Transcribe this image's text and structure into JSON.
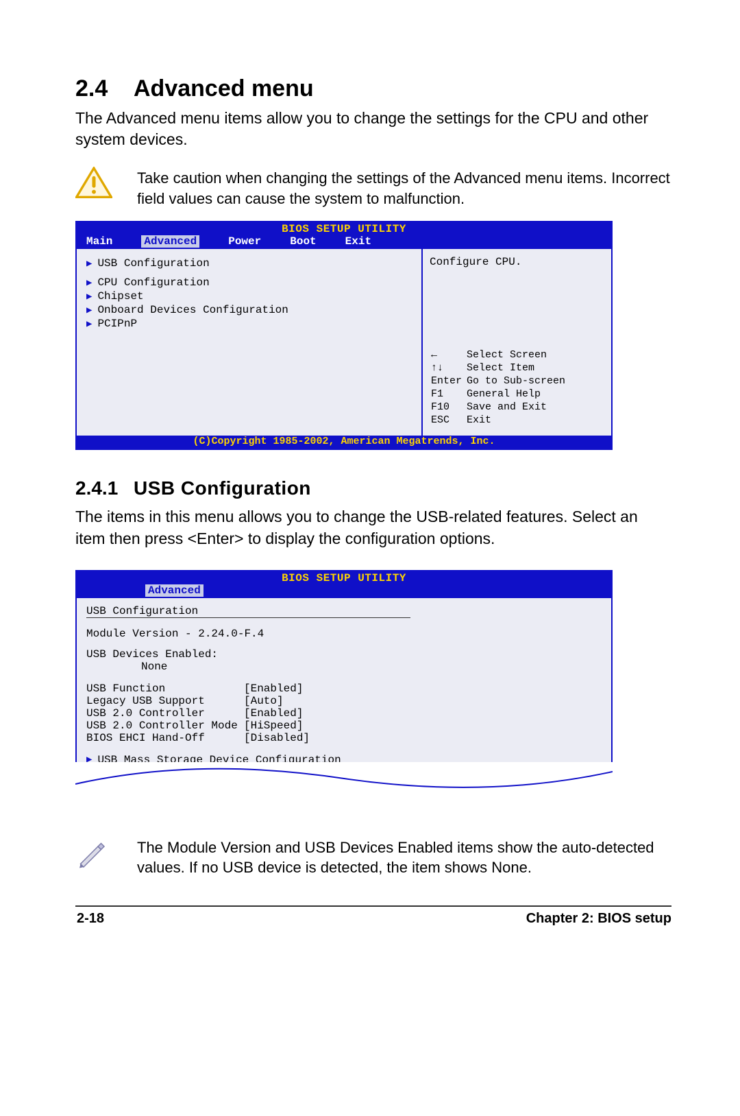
{
  "section": {
    "num": "2.4",
    "title": "Advanced menu"
  },
  "intro": "The Advanced menu items allow you to change the settings for the CPU and other system devices.",
  "caution": "Take caution when changing the settings of the Advanced menu items. Incorrect field values can cause the system to malfunction.",
  "bios1": {
    "title": "BIOS SETUP UTILITY",
    "tabs": [
      "Main",
      "Advanced",
      "Power",
      "Boot",
      "Exit"
    ],
    "activeTab": "Advanced",
    "items": [
      "USB Configuration",
      "CPU Configuration",
      "Chipset",
      "Onboard Devices Configuration",
      "PCIPnP"
    ],
    "rightTop": "Configure CPU.",
    "keys": [
      {
        "k": "←",
        "d": "Select Screen"
      },
      {
        "k": "↑↓",
        "d": "Select Item"
      },
      {
        "k": "Enter",
        "d": "Go to Sub-screen"
      },
      {
        "k": "F1",
        "d": "General Help"
      },
      {
        "k": "F10",
        "d": "Save and Exit"
      },
      {
        "k": "ESC",
        "d": "Exit"
      }
    ],
    "copyright": "(C)Copyright 1985-2002, American Megatrends, Inc."
  },
  "subsection": {
    "num": "2.4.1",
    "title": "USB Configuration"
  },
  "sub_intro": "The items in this menu allows you to change the USB-related features. Select an item then press <Enter> to display the configuration options.",
  "bios2": {
    "title": "BIOS SETUP UTILITY",
    "tab": "Advanced",
    "heading": "USB Configuration",
    "module": "Module Version - 2.24.0-F.4",
    "devLabel": "USB Devices Enabled:",
    "devValue": "None",
    "settings": [
      {
        "label": "USB Function",
        "value": "[Enabled]"
      },
      {
        "label": "Legacy USB Support",
        "value": "[Auto]"
      },
      {
        "label": "USB 2.0 Controller",
        "value": "[Enabled]"
      },
      {
        "label": "USB 2.0 Controller Mode",
        "value": "[HiSpeed]"
      },
      {
        "label": "BIOS EHCI Hand-Off",
        "value": "[Disabled]"
      }
    ],
    "submenu": "USB Mass Storage Device Configuration"
  },
  "note": "The Module Version and USB Devices Enabled items show the auto-detected values. If no USB device is detected, the item shows None.",
  "footer": {
    "page": "2-18",
    "chapter": "Chapter 2: BIOS setup"
  }
}
